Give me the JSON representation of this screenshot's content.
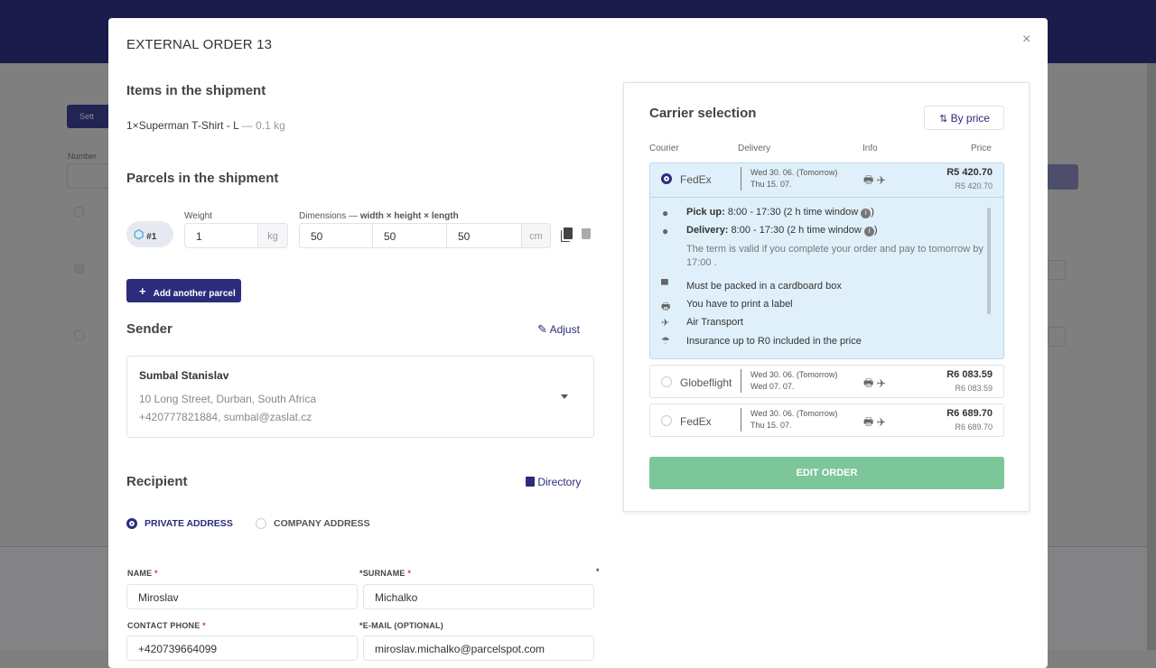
{
  "background": {
    "settings_button": "Sett",
    "number_label": "Number",
    "col_c": "C",
    "row1": "#",
    "row2": "#",
    "right_btn": "te",
    "right_btn2": "il"
  },
  "modal": {
    "title": "EXTERNAL ORDER 13",
    "close": "×"
  },
  "items": {
    "heading": "Items in the shipment",
    "qty": "1×",
    "name": "Superman T-Shirt - L",
    "weight": "— 0.1 kg"
  },
  "parcels": {
    "heading": "Parcels in the shipment",
    "parcel_no": "#1",
    "weight_label": "Weight",
    "weight": "1",
    "weight_unit": "kg",
    "dims_label": "Dimensions — ",
    "dims_label_bold": "width × height × length",
    "width": "50",
    "height": "50",
    "length": "50",
    "dims_unit": "cm",
    "add_label": "Add another parcel"
  },
  "sender": {
    "heading": "Sender",
    "adjust": "Adjust",
    "name": "Sumbal Stanislav",
    "address": "10 Long Street, Durban, South Africa",
    "contact": "+420777821884, sumbal@zaslat.cz"
  },
  "recipient": {
    "heading": "Recipient",
    "directory": "Directory",
    "private": "PRIVATE ADDRESS",
    "company": "COMPANY ADDRESS",
    "address_type": "private",
    "name_label": "NAME",
    "name": "Miroslav",
    "surname_label": "SURNAME",
    "surname": "Michalko",
    "phone_label": "CONTACT PHONE",
    "phone": "+420739664099",
    "email_label": "E-MAIL (OPTIONAL)",
    "email": "miroslav.michalko@parcelspot.com",
    "asterisk": "*"
  },
  "carrier": {
    "heading": "Carrier selection",
    "sort": "By price",
    "columns": {
      "courier": "Courier",
      "delivery": "Delivery",
      "info": "Info",
      "price": "Price"
    },
    "options": [
      {
        "courier": "FedEx",
        "from": "Wed 30. 06.  (Tomorrow)",
        "to": "Thu 15. 07.",
        "price": "R5 420.70",
        "price_sub": "R5 420.70",
        "selected": true
      },
      {
        "courier": "Globeflight",
        "from": "Wed 30. 06.  (Tomorrow)",
        "to": "Wed 07. 07.",
        "price": "R6 083.59",
        "price_sub": "R6 083.59",
        "selected": false
      },
      {
        "courier": "FedEx",
        "from": "Wed 30. 06.  (Tomorrow)",
        "to": "Thu 15. 07.",
        "price": "R6 689.70",
        "price_sub": "R6 689.70",
        "selected": false
      }
    ],
    "details": {
      "pickup_label": "Pick up:",
      "pickup": "8:00 - 17:30 (2 h time window",
      "delivery_label": "Delivery:",
      "delivery": "8:00 - 17:30 (2 h time window",
      "close_paren": ")",
      "note": "The term is valid if you complete your order and pay to tomorrow by 17:00 .",
      "box": "Must be packed in a cardboard box",
      "label": "You have to print a label",
      "air": "Air Transport",
      "insurance": "Insurance up to R0 included in the price"
    },
    "edit_order": "EDIT ORDER"
  },
  "colors": {
    "primary": "#2b2c7c",
    "selected_bg": "#dff0fa",
    "success": "#7dc699"
  }
}
